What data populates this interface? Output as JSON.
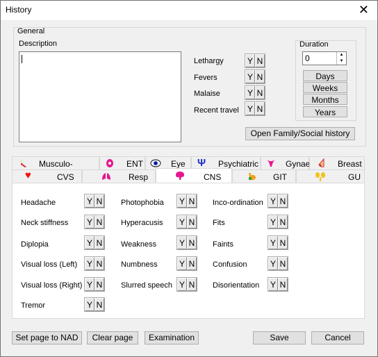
{
  "window": {
    "title": "History"
  },
  "general": {
    "group_label": "General",
    "description_label": "Description",
    "description_value": "",
    "symptoms": [
      {
        "label": "Lethargy",
        "yes": "Y",
        "no": "N"
      },
      {
        "label": "Fevers",
        "yes": "Y",
        "no": "N"
      },
      {
        "label": "Malaise",
        "yes": "Y",
        "no": "N"
      },
      {
        "label": "Recent travel",
        "yes": "Y",
        "no": "N"
      }
    ],
    "duration": {
      "label": "Duration",
      "value": "0",
      "units": [
        "Days",
        "Weeks",
        "Months",
        "Years"
      ]
    },
    "family_button": "Open Family/Social history"
  },
  "tabs_row1": [
    {
      "label": "Musculo-skeletal",
      "icon": "bone-icon"
    },
    {
      "label": "ENT",
      "icon": "ear-icon"
    },
    {
      "label": "Eye",
      "icon": "eye-icon"
    },
    {
      "label": "Psychiatric",
      "icon": "psi-icon"
    },
    {
      "label": "Gynae",
      "icon": "uterus-icon"
    },
    {
      "label": "Breast",
      "icon": "breast-icon"
    }
  ],
  "tabs_row2": [
    {
      "label": "CVS",
      "icon": "heart-icon"
    },
    {
      "label": "Resp",
      "icon": "lungs-icon"
    },
    {
      "label": "CNS",
      "icon": "brain-icon"
    },
    {
      "label": "GIT",
      "icon": "stomach-icon"
    },
    {
      "label": "GU",
      "icon": "kidney-icon"
    }
  ],
  "active_tab": "CNS",
  "cns": {
    "col1": [
      "Headache",
      "Neck stiffness",
      "Diplopia",
      "Visual loss (Left)",
      "Visual loss (Right)",
      "Tremor"
    ],
    "col2": [
      "Photophobia",
      "Hyperacusis",
      "Weakness",
      "Numbness",
      "Slurred speech"
    ],
    "col3": [
      "Inco-ordination",
      "Fits",
      "Faints",
      "Confusion",
      "Disorientation"
    ],
    "yes": "Y",
    "no": "N"
  },
  "footer": {
    "set_nad": "Set page to NAD",
    "clear_page": "Clear page",
    "examination": "Examination",
    "save": "Save",
    "cancel": "Cancel"
  },
  "colors": {
    "window_bg": "#f0f0f0",
    "panel_bg": "#ffffff",
    "button_bg": "#e1e1e1"
  }
}
